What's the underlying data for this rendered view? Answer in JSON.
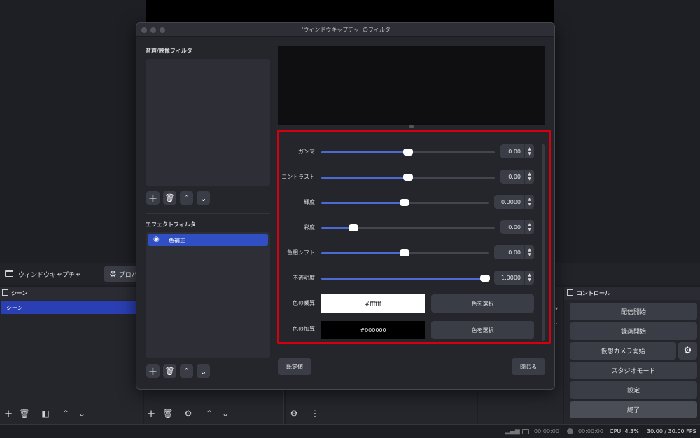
{
  "main_window": {
    "source_name": "ウィンドウキャプチャ",
    "properties_label": "プロパ",
    "scenes": {
      "title": "シーン",
      "items": [
        "シーン"
      ]
    },
    "controls": {
      "title": "コントロール",
      "buttons": [
        "配信開始",
        "録画開始",
        "仮想カメラ開始",
        "スタジオモード",
        "設定",
        "終了"
      ]
    },
    "status": {
      "stream_time": "00:00:00",
      "rec_time": "00:00:00",
      "cpu": "CPU: 4.3%",
      "fps": "30.00 / 30.00 FPS"
    }
  },
  "dialog": {
    "title": "'ウィンドウキャプチャ' のフィルタ",
    "av_filters_label": "音声/映像フィルタ",
    "effect_filters_label": "エフェクトフィルタ",
    "effect_filter_items": [
      {
        "name": "色補正",
        "selected": true
      }
    ],
    "defaults_button": "既定値",
    "close_button": "閉じる",
    "params": [
      {
        "label": "ガンマ",
        "value": "0.00",
        "level": 0.5
      },
      {
        "label": "コントラスト",
        "value": "0.00",
        "level": 0.5
      },
      {
        "label": "輝度",
        "value": "0.0000",
        "level": 0.5
      },
      {
        "label": "彩度",
        "value": "0.00",
        "level": 0.18
      },
      {
        "label": "色相シフト",
        "value": "0.00",
        "level": 0.5
      },
      {
        "label": "不透明度",
        "value": "1.0000",
        "level": 1.0
      }
    ],
    "color_multiply": {
      "label": "色の乗算",
      "value": "#ffffff",
      "button": "色を選択"
    },
    "color_add": {
      "label": "色の加算",
      "value": "#000000",
      "button": "色を選択"
    }
  },
  "colors": {
    "highlight_border": "#d4000f",
    "selection_blue": "#2f4fc2",
    "scene_selected": "#2a3fb3",
    "slider_fill": "#4a6bd1"
  }
}
